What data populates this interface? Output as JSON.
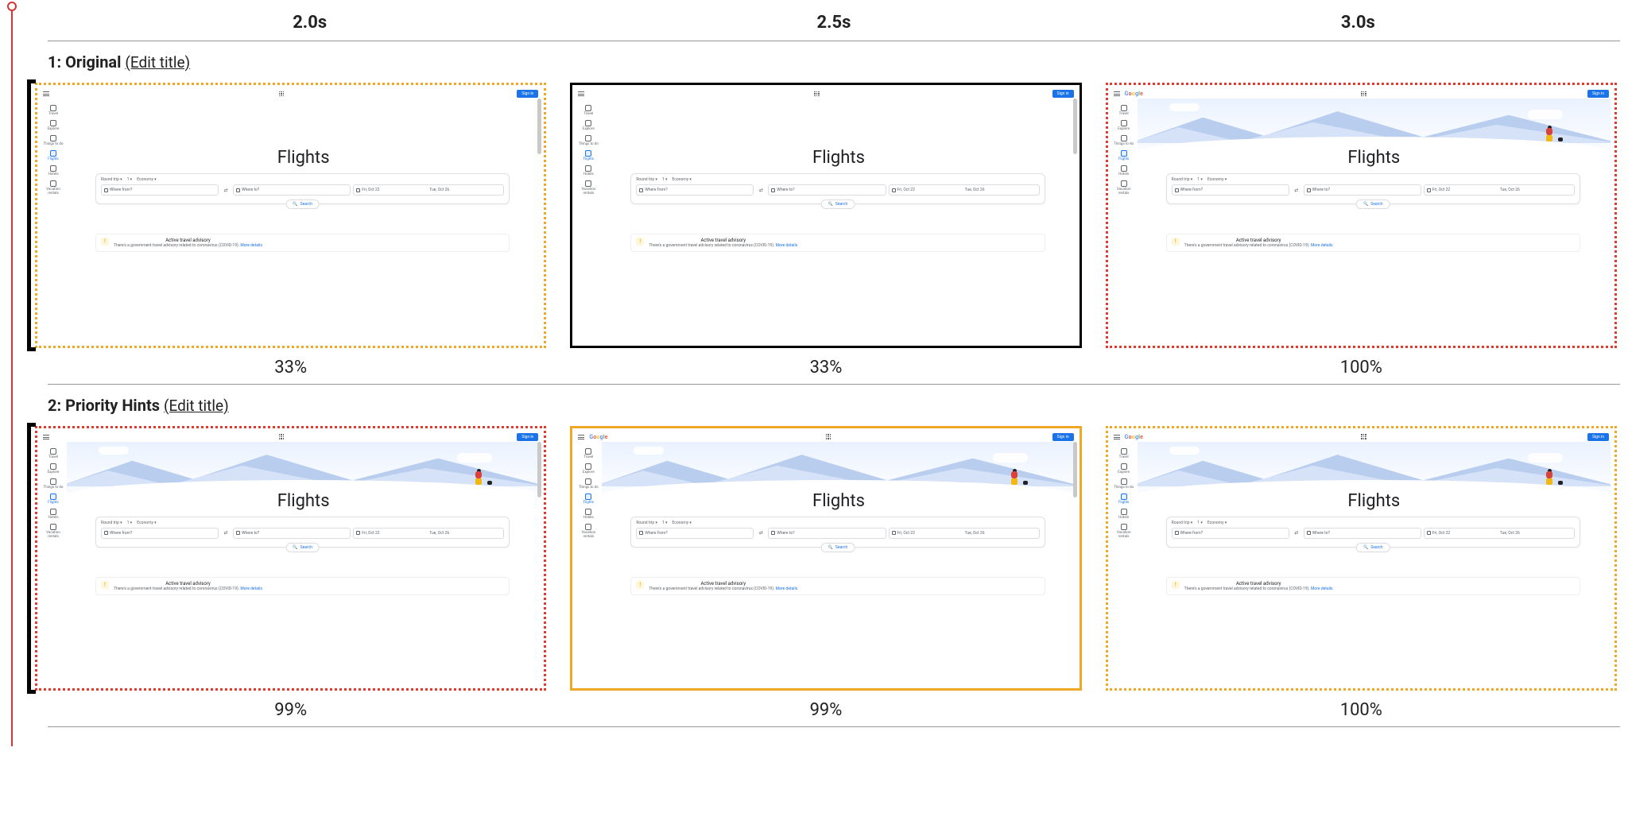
{
  "timeHeaders": [
    "2.0s",
    "2.5s",
    "3.0s"
  ],
  "editTitleLabel": "(Edit title)",
  "rows": [
    {
      "index": "1",
      "title": "Original",
      "frames": [
        {
          "borderClass": "dotted-orange",
          "leftBlack": true,
          "showLogo": false,
          "showHero": false,
          "showScrollbar": true,
          "pct": "33%"
        },
        {
          "borderClass": "solid-black",
          "leftBlack": false,
          "showLogo": false,
          "showHero": false,
          "showScrollbar": true,
          "pct": "33%"
        },
        {
          "borderClass": "dotted-red",
          "leftBlack": false,
          "showLogo": true,
          "showHero": true,
          "showScrollbar": false,
          "pct": "100%"
        }
      ]
    },
    {
      "index": "2",
      "title": "Priority Hints",
      "frames": [
        {
          "borderClass": "dotted-red",
          "leftBlack": true,
          "showLogo": false,
          "showHero": true,
          "showScrollbar": true,
          "pct": "99%"
        },
        {
          "borderClass": "solid-orange",
          "leftBlack": false,
          "showLogo": true,
          "showHero": true,
          "showScrollbar": true,
          "pct": "99%"
        },
        {
          "borderClass": "dotted-orange",
          "leftBlack": false,
          "showLogo": true,
          "showHero": true,
          "showScrollbar": false,
          "pct": "100%"
        }
      ]
    }
  ],
  "miniPage": {
    "signIn": "Sign in",
    "logoText": "Google",
    "title": "Flights",
    "sidebar": [
      {
        "label": "Travel",
        "active": false
      },
      {
        "label": "Explore",
        "active": false
      },
      {
        "label": "Things to do",
        "active": false
      },
      {
        "label": "Flights",
        "active": true
      },
      {
        "label": "Hotels",
        "active": false
      },
      {
        "label": "Vacation rentals",
        "active": false
      }
    ],
    "chips": {
      "trip": "Round trip",
      "pax": "1",
      "cabin": "Economy"
    },
    "fields": {
      "fromPlaceholder": "Where from?",
      "toPlaceholder": "Where to?",
      "date1": "Fri, Oct 22",
      "date2": "Tue, Oct 26"
    },
    "searchBtn": "Search",
    "advisory": {
      "title": "Active travel advisory",
      "body": "There's a government travel advisory related to coronavirus (COVID-19).",
      "link": "More details"
    }
  }
}
